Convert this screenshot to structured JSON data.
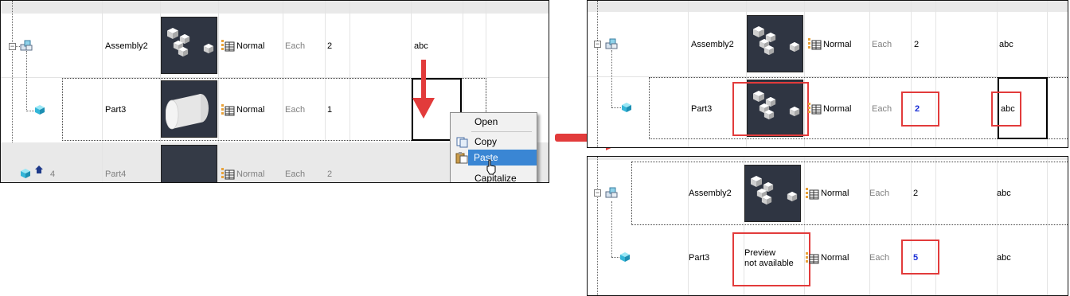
{
  "before_panel": {
    "rows": [
      {
        "name": "Assembly2",
        "type": "Normal",
        "unit": "Each",
        "qty": "2",
        "value": "abc"
      },
      {
        "name": "Part3",
        "type": "Normal",
        "unit": "Each",
        "qty": "1",
        "value": ""
      },
      {
        "number": "4",
        "name": "Part4",
        "type": "Normal",
        "unit": "Each",
        "qty": "2"
      }
    ],
    "context_menu": {
      "items": [
        "Open",
        "Copy",
        "Paste",
        "Capitalize"
      ],
      "selected": "Paste"
    }
  },
  "after_paste_panel": {
    "rows": [
      {
        "name": "Assembly2",
        "type": "Normal",
        "unit": "Each",
        "qty": "2",
        "value": "abc"
      },
      {
        "name": "Part3",
        "type": "Normal",
        "unit": "Each",
        "qty": "2",
        "value": "abc"
      }
    ]
  },
  "after_change_panel": {
    "rows": [
      {
        "name": "Assembly2",
        "type": "Normal",
        "unit": "Each",
        "qty": "2",
        "value": "abc"
      },
      {
        "name": "Part3",
        "type": "Normal",
        "unit": "Each",
        "qty": "5",
        "value": "abc",
        "preview_line1": "Preview",
        "preview_line2": "not available"
      }
    ]
  },
  "colors": {
    "arrow": "#e23b3b",
    "highlight_box": "#e23b3b",
    "thumbnail_bg": "#2f3542",
    "menu_highlight": "#3a86d4",
    "changed_qty": "#1a2fd6"
  },
  "icons": [
    "tree-expander-icon",
    "assembly-icon",
    "part-icon",
    "part-pin-icon",
    "bom-structure-icon",
    "copy-icon",
    "paste-icon",
    "mouse-cursor-icon"
  ]
}
